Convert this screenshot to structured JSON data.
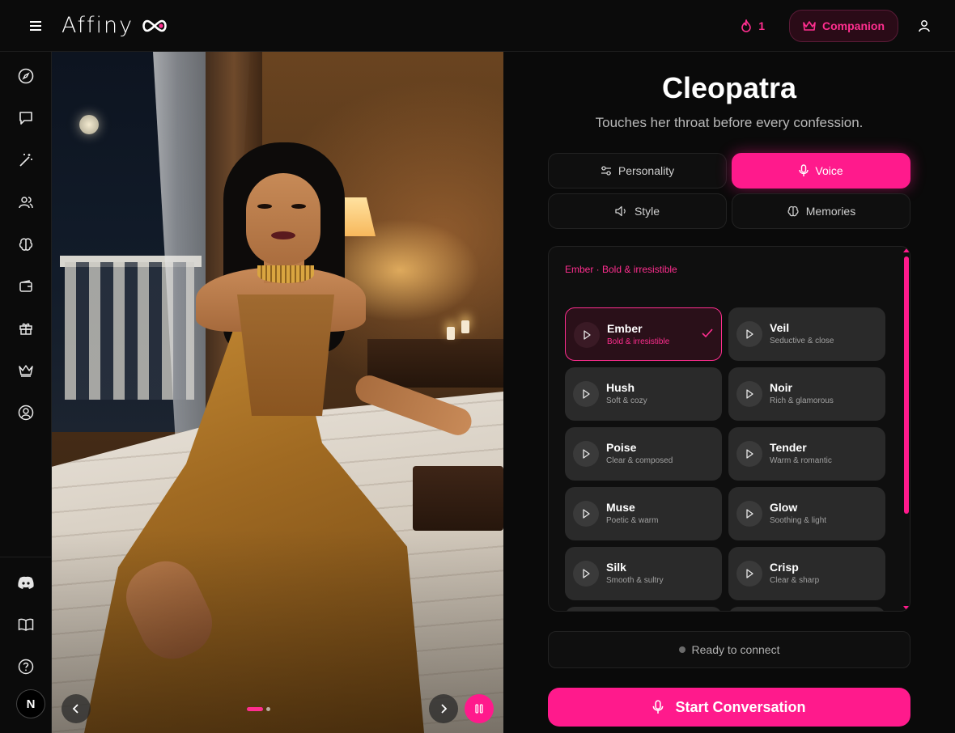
{
  "header": {
    "logo_text": "Affiny",
    "streak_count": "1",
    "companion_label": "Companion"
  },
  "sidebar": {
    "items": [
      {
        "icon": "compass-icon"
      },
      {
        "icon": "chat-icon"
      },
      {
        "icon": "magic-wand-icon"
      },
      {
        "icon": "users-icon"
      },
      {
        "icon": "brain-icon"
      },
      {
        "icon": "wallet-icon"
      },
      {
        "icon": "gift-icon"
      },
      {
        "icon": "crown-icon"
      },
      {
        "icon": "user-circle-icon"
      }
    ],
    "bottom_items": [
      {
        "icon": "discord-icon"
      },
      {
        "icon": "book-icon"
      },
      {
        "icon": "help-icon"
      }
    ],
    "avatar_initial": "N"
  },
  "character": {
    "name": "Cleopatra",
    "tagline": "Touches her throat before every confession."
  },
  "tabs": [
    {
      "label": "Personality",
      "icon": "sliders-icon",
      "active": false
    },
    {
      "label": "Voice",
      "icon": "mic-icon",
      "active": true
    },
    {
      "label": "Style",
      "icon": "speaker-icon",
      "active": false
    },
    {
      "label": "Memories",
      "icon": "brain-icon",
      "active": false
    }
  ],
  "voice": {
    "selected_header": "Ember · Bold & irresistible",
    "options": [
      {
        "name": "Ember",
        "desc": "Bold & irresistible",
        "selected": true
      },
      {
        "name": "Veil",
        "desc": "Seductive & close",
        "selected": false
      },
      {
        "name": "Hush",
        "desc": "Soft & cozy",
        "selected": false
      },
      {
        "name": "Noir",
        "desc": "Rich & glamorous",
        "selected": false
      },
      {
        "name": "Poise",
        "desc": "Clear & composed",
        "selected": false
      },
      {
        "name": "Tender",
        "desc": "Warm & romantic",
        "selected": false
      },
      {
        "name": "Muse",
        "desc": "Poetic & warm",
        "selected": false
      },
      {
        "name": "Glow",
        "desc": "Soothing & light",
        "selected": false
      },
      {
        "name": "Silk",
        "desc": "Smooth & sultry",
        "selected": false
      },
      {
        "name": "Crisp",
        "desc": "Clear & sharp",
        "selected": false
      }
    ]
  },
  "status": {
    "text": "Ready to connect"
  },
  "start_button": {
    "label": "Start Conversation"
  },
  "colors": {
    "accent": "#ff1a8c",
    "background": "#0a0a0a",
    "card": "#2a2a2a"
  }
}
